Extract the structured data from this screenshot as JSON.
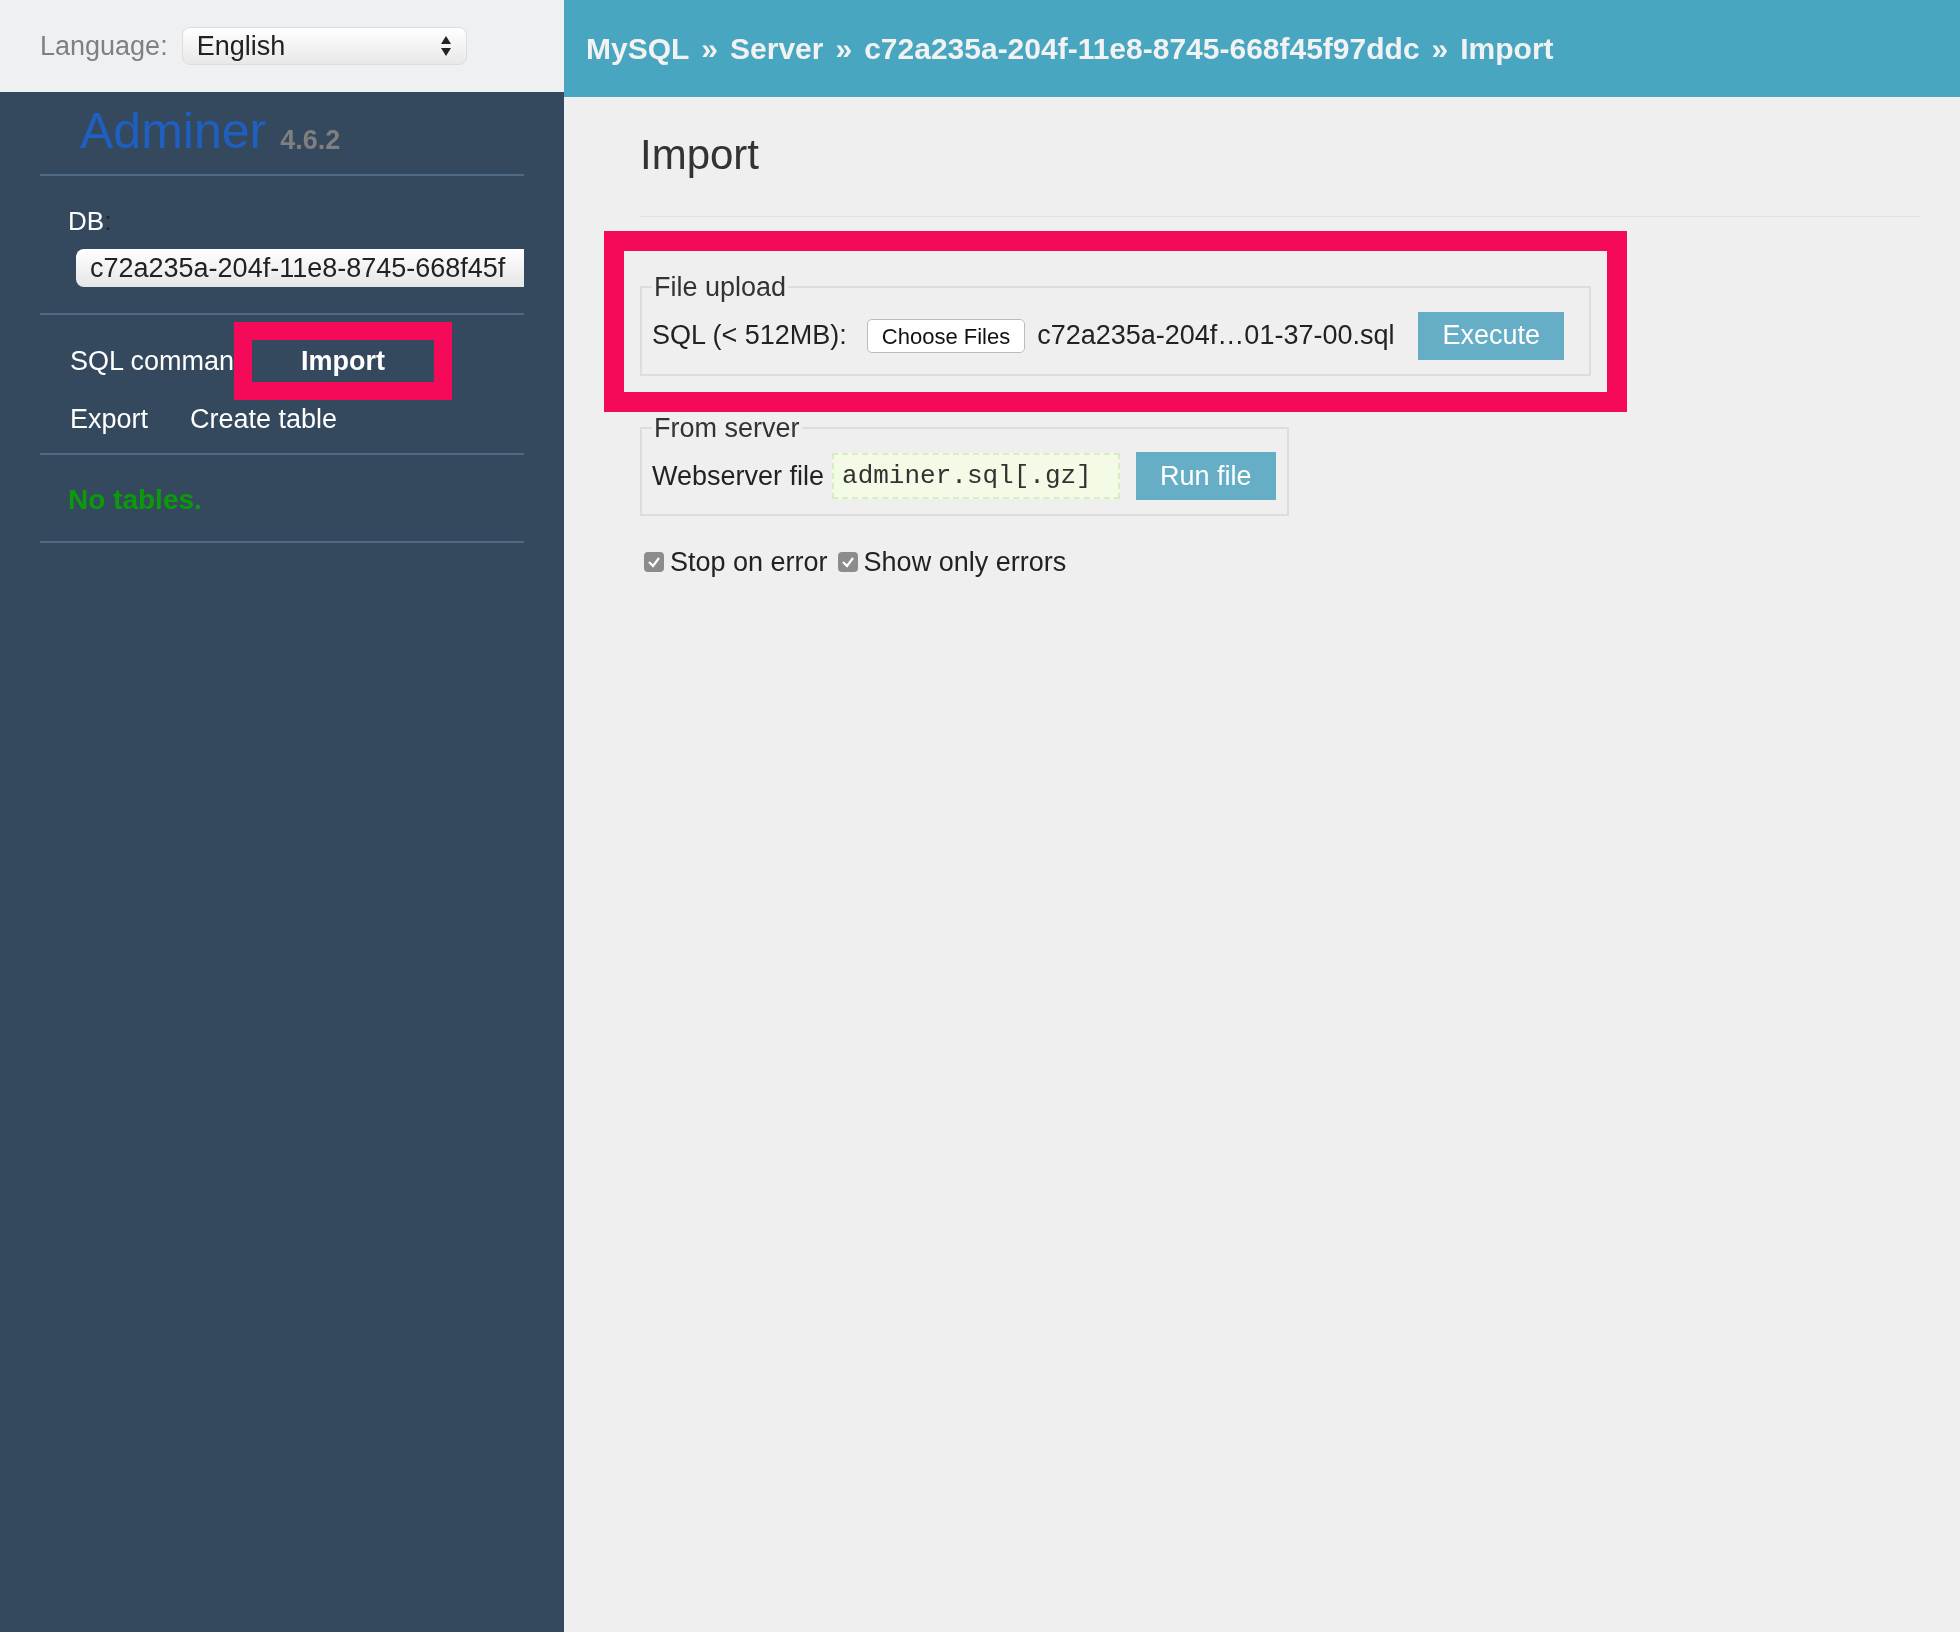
{
  "language": {
    "label": "Language:",
    "value": "English"
  },
  "app": {
    "name": "Adminer",
    "version": "4.6.2"
  },
  "db": {
    "label": "DB",
    "separator": ":",
    "value": "c72a235a-204f-11e8-8745-668f45f"
  },
  "links": [
    {
      "label": "SQL comman",
      "highlighted": false
    },
    {
      "label": "Import",
      "highlighted": true
    },
    {
      "label": "Export",
      "highlighted": false
    },
    {
      "label": "Create table",
      "highlighted": false
    }
  ],
  "no_tables": "No tables.",
  "breadcrumb": [
    {
      "label": "MySQL"
    },
    {
      "label": "Server"
    },
    {
      "label": "c72a235a-204f-11e8-8745-668f45f97ddc"
    },
    {
      "label": "Import"
    }
  ],
  "breadcrumb_separator": "»",
  "title": "Import",
  "file_upload": {
    "legend": "File upload",
    "highlighted": true,
    "label": "SQL (< 512MB):",
    "choose_button": "Choose Files",
    "file_name": "c72a235a-204f…01-37-00.sql",
    "button": "Execute"
  },
  "from_server": {
    "legend": "From server",
    "label": "Webserver file",
    "placeholder": "adminer.sql[.gz]",
    "button": "Run file"
  },
  "options": [
    {
      "label": "Stop on error",
      "checked": true
    },
    {
      "label": "Show only errors",
      "checked": true
    }
  ]
}
